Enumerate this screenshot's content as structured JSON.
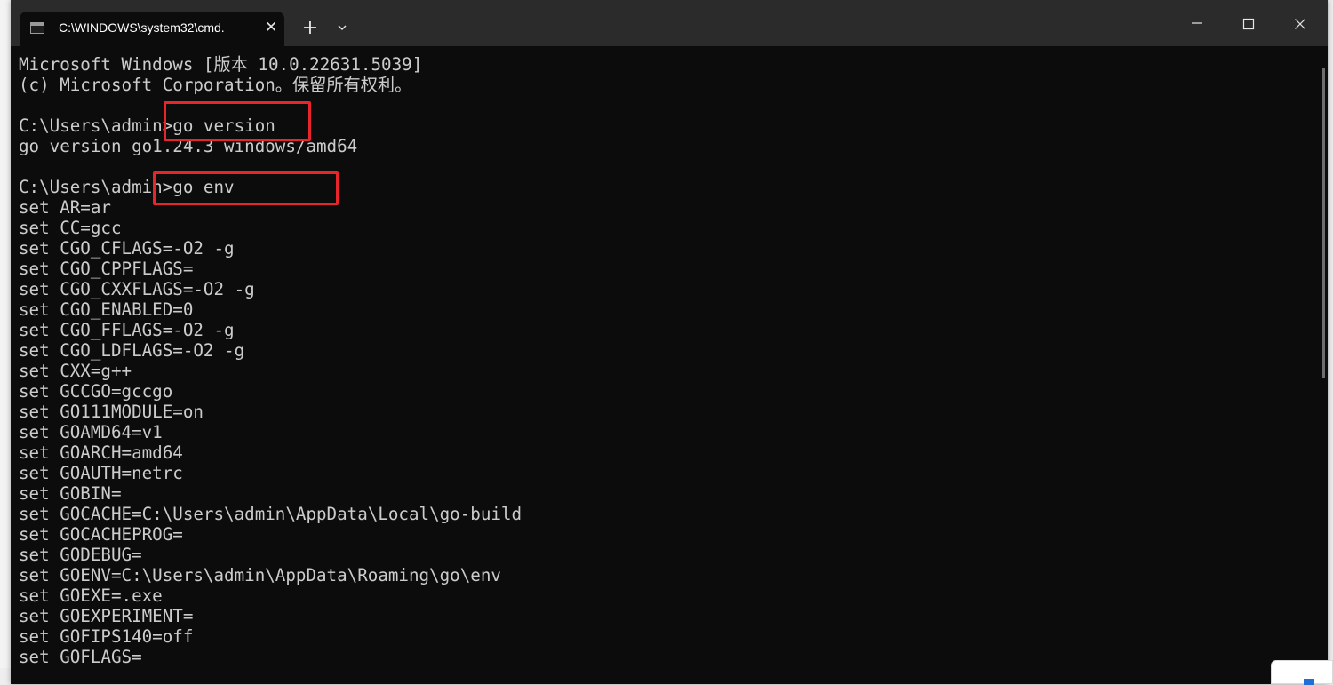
{
  "window": {
    "tab_title": "C:\\WINDOWS\\system32\\cmd.",
    "tab_icon": "cmd-icon",
    "new_tab_label": "+",
    "tab_close_label": "✕"
  },
  "colors": {
    "titlebar": "#2b2b2b",
    "terminal_bg": "#0c0c0c",
    "terminal_text": "#cccccc",
    "highlight": "#e8252a"
  },
  "terminal": {
    "lines": [
      "Microsoft Windows [版本 10.0.22631.5039]",
      "(c) Microsoft Corporation。保留所有权利。",
      "",
      "C:\\Users\\admin>go version",
      "go version go1.24.3 windows/amd64",
      "",
      "C:\\Users\\admin>go env",
      "set AR=ar",
      "set CC=gcc",
      "set CGO_CFLAGS=-O2 -g",
      "set CGO_CPPFLAGS=",
      "set CGO_CXXFLAGS=-O2 -g",
      "set CGO_ENABLED=0",
      "set CGO_FFLAGS=-O2 -g",
      "set CGO_LDFLAGS=-O2 -g",
      "set CXX=g++",
      "set GCCGO=gccgo",
      "set GO111MODULE=on",
      "set GOAMD64=v1",
      "set GOARCH=amd64",
      "set GOAUTH=netrc",
      "set GOBIN=",
      "set GOCACHE=C:\\Users\\admin\\AppData\\Local\\go-build",
      "set GOCACHEPROG=",
      "set GODEBUG=",
      "set GOENV=C:\\Users\\admin\\AppData\\Roaming\\go\\env",
      "set GOEXE=.exe",
      "set GOEXPERIMENT=",
      "set GOFIPS140=off",
      "set GOFLAGS="
    ]
  }
}
